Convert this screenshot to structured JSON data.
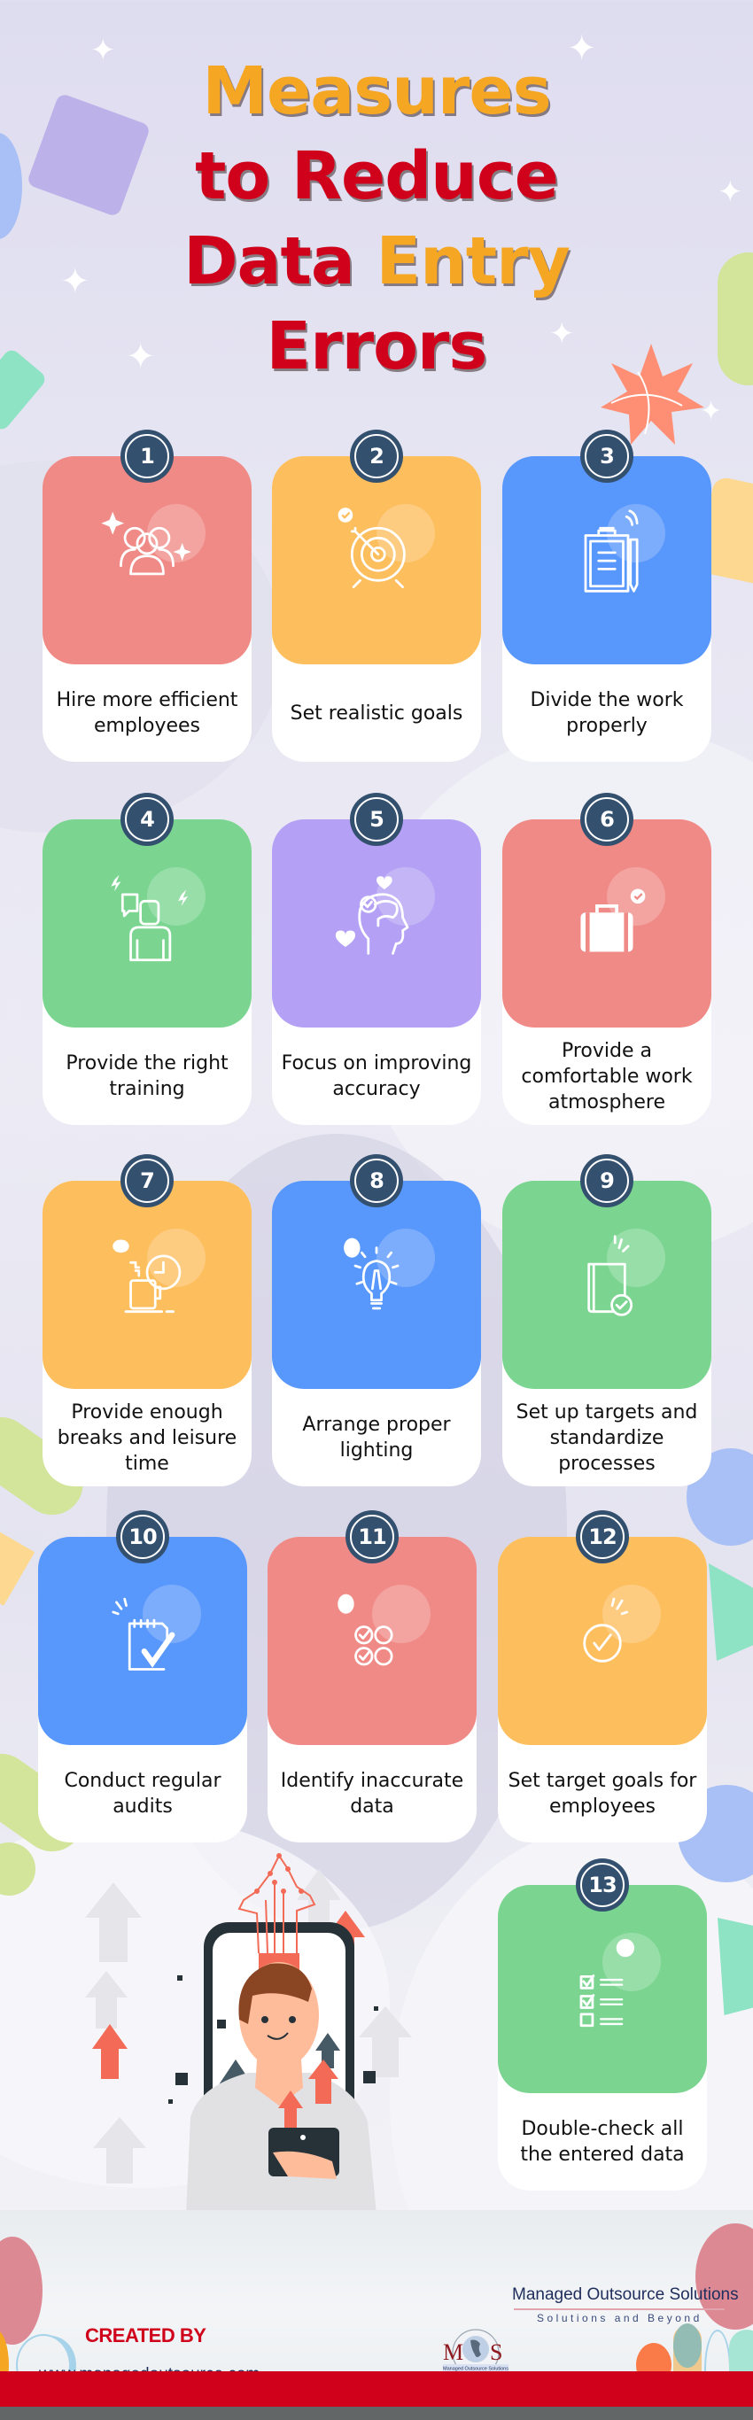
{
  "title": {
    "line1": "Measures",
    "line2": "to Reduce",
    "line3_part1": "Data ",
    "line3_part2": "Entry",
    "line4": "Errors"
  },
  "colors": {
    "title_orange": "#f5a623",
    "title_red": "#d0021b",
    "badge": "#34506f",
    "coral": "#f08a86",
    "amber": "#fdbe5e",
    "blue": "#5897fb",
    "green": "#7bd591",
    "purple": "#b4a1f5"
  },
  "measures": [
    {
      "number": "1",
      "label": "Hire more efficient employees",
      "color": "coral",
      "icon": "team-icon"
    },
    {
      "number": "2",
      "label": "Set realistic goals",
      "color": "amber",
      "icon": "target-icon"
    },
    {
      "number": "3",
      "label": "Divide the work properly",
      "color": "blue",
      "icon": "clipboard-icon"
    },
    {
      "number": "4",
      "label": "Provide the right training",
      "color": "green",
      "icon": "trainee-icon"
    },
    {
      "number": "5",
      "label": "Focus on improving accuracy",
      "color": "purple",
      "icon": "mind-icon"
    },
    {
      "number": "6",
      "label": "Provide a comfortable work atmosphere",
      "color": "coral",
      "icon": "briefcase-icon"
    },
    {
      "number": "7",
      "label": "Provide enough breaks and leisure time",
      "color": "amber",
      "icon": "coffee-break-icon"
    },
    {
      "number": "8",
      "label": "Arrange proper lighting",
      "color": "blue",
      "icon": "light-bulb-icon"
    },
    {
      "number": "9",
      "label": "Set up targets and standardize processes",
      "color": "green",
      "icon": "book-check-icon"
    },
    {
      "number": "10",
      "label": "Conduct regular audits",
      "color": "blue",
      "icon": "notepad-check-icon"
    },
    {
      "number": "11",
      "label": "Identify inaccurate data",
      "color": "coral",
      "icon": "checklist-circles-icon"
    },
    {
      "number": "12",
      "label": "Set target goals for employees",
      "color": "amber",
      "icon": "check-circle-icon"
    },
    {
      "number": "13",
      "label": "Double-check all the entered data",
      "color": "green",
      "icon": "checkbox-list-icon"
    }
  ],
  "footer": {
    "created_by": "CREATED BY",
    "website": "www.managedoutsource.com",
    "brand_name": "Managed Outsource Solutions",
    "tagline": "Solutions and Beyond",
    "logo_text": "MOS",
    "logo_subtext": "Managed Outsource Solutions"
  }
}
